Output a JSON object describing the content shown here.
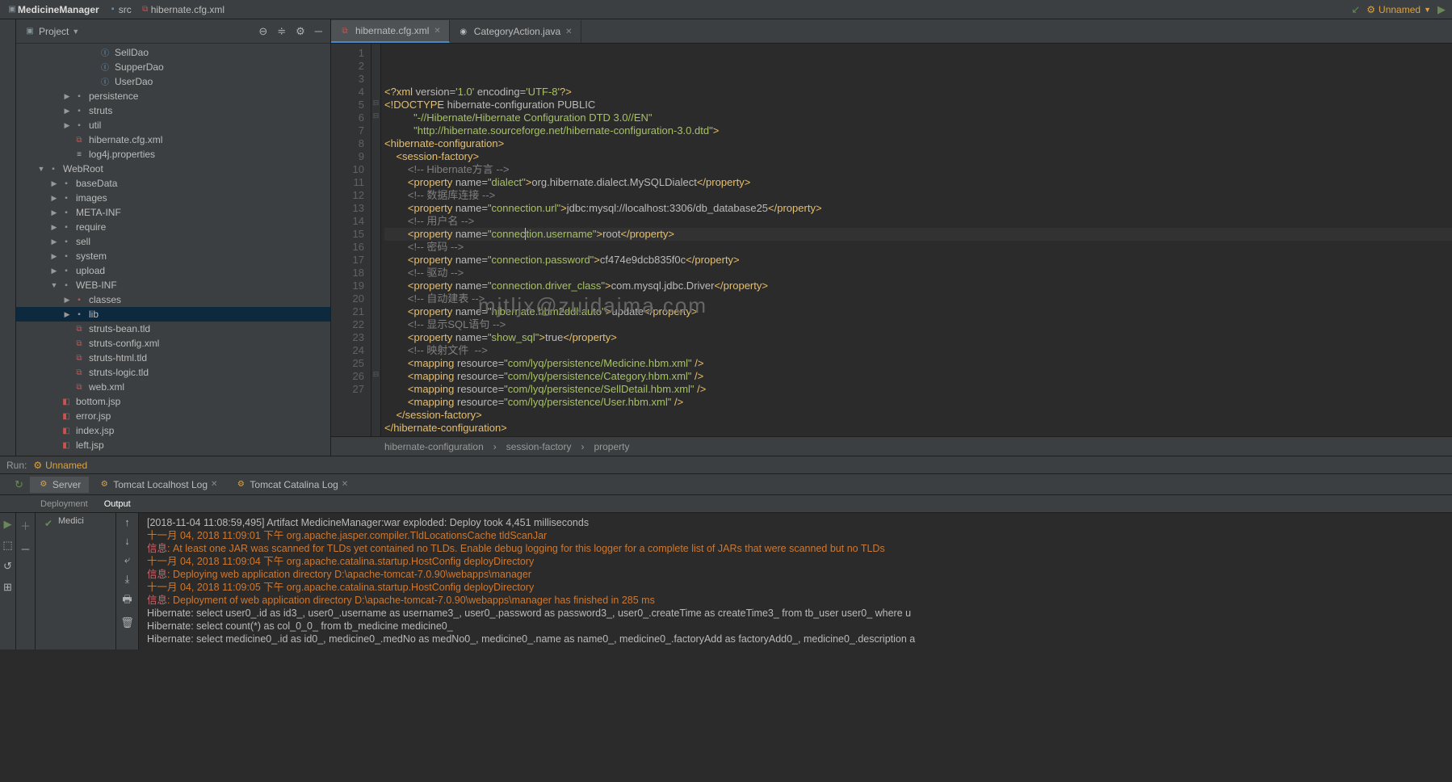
{
  "topBar": {
    "projectName": "MedicineManager",
    "path1": "src",
    "path2": "hibernate.cfg.xml",
    "runConfig": "Unnamed"
  },
  "projectPanel": {
    "title": "Project"
  },
  "tree": [
    {
      "indent": 5,
      "icon": "int",
      "label": "SellDao"
    },
    {
      "indent": 5,
      "icon": "int",
      "label": "SupperDao"
    },
    {
      "indent": 5,
      "icon": "int",
      "label": "UserDao"
    },
    {
      "indent": 3,
      "arrow": "▶",
      "icon": "folder",
      "label": "persistence"
    },
    {
      "indent": 3,
      "arrow": "▶",
      "icon": "folder",
      "label": "struts"
    },
    {
      "indent": 3,
      "arrow": "▶",
      "icon": "folder",
      "label": "util"
    },
    {
      "indent": 3,
      "icon": "xml",
      "label": "hibernate.cfg.xml"
    },
    {
      "indent": 3,
      "icon": "prop",
      "label": "log4j.properties"
    },
    {
      "indent": 1,
      "arrow": "▼",
      "icon": "folder",
      "label": "WebRoot"
    },
    {
      "indent": 2,
      "arrow": "▶",
      "icon": "folder",
      "label": "baseData"
    },
    {
      "indent": 2,
      "arrow": "▶",
      "icon": "folder",
      "label": "images"
    },
    {
      "indent": 2,
      "arrow": "▶",
      "icon": "folder",
      "label": "META-INF"
    },
    {
      "indent": 2,
      "arrow": "▶",
      "icon": "folder",
      "label": "require"
    },
    {
      "indent": 2,
      "arrow": "▶",
      "icon": "folder",
      "label": "sell"
    },
    {
      "indent": 2,
      "arrow": "▶",
      "icon": "folder",
      "label": "system"
    },
    {
      "indent": 2,
      "arrow": "▶",
      "icon": "folder",
      "label": "upload"
    },
    {
      "indent": 2,
      "arrow": "▼",
      "icon": "folder",
      "label": "WEB-INF"
    },
    {
      "indent": 3,
      "arrow": "▶",
      "icon": "folder-red",
      "label": "classes"
    },
    {
      "indent": 3,
      "arrow": "▶",
      "icon": "folder",
      "label": "lib",
      "selected": true
    },
    {
      "indent": 3,
      "icon": "xml",
      "label": "struts-bean.tld"
    },
    {
      "indent": 3,
      "icon": "xml",
      "label": "struts-config.xml"
    },
    {
      "indent": 3,
      "icon": "xml",
      "label": "struts-html.tld"
    },
    {
      "indent": 3,
      "icon": "xml",
      "label": "struts-logic.tld"
    },
    {
      "indent": 3,
      "icon": "xml",
      "label": "web.xml"
    },
    {
      "indent": 2,
      "icon": "jsp",
      "label": "bottom.jsp"
    },
    {
      "indent": 2,
      "icon": "jsp",
      "label": "error.jsp"
    },
    {
      "indent": 2,
      "icon": "jsp",
      "label": "index.jsp"
    },
    {
      "indent": 2,
      "icon": "jsp",
      "label": "left.jsp"
    }
  ],
  "tabs": [
    {
      "icon": "xml",
      "label": "hibernate.cfg.xml",
      "active": true
    },
    {
      "icon": "java",
      "label": "CategoryAction.java"
    }
  ],
  "code": {
    "lines": [
      {
        "n": 1,
        "html": "<span class='t-pi'>&lt;?xml</span><span class='t-attr'> version=</span><span class='t-str'>'1.0'</span><span class='t-attr'> encoding=</span><span class='t-str'>'UTF-8'</span><span class='t-pi'>?&gt;</span>"
      },
      {
        "n": 2,
        "html": "<span class='t-doctype'>&lt;!DOCTYPE</span><span class='t-text'> hibernate-configuration PUBLIC</span>"
      },
      {
        "n": 3,
        "html": "          <span class='t-str'>\"-//Hibernate/Hibernate Configuration DTD 3.0//EN\"</span>"
      },
      {
        "n": 4,
        "html": "          <span class='t-str'>\"http://hibernate.sourceforge.net/hibernate-configuration-3.0.dtd\"</span><span class='t-doctype'>&gt;</span>"
      },
      {
        "n": 5,
        "html": "<span class='t-tag'>&lt;hibernate-configuration&gt;</span>"
      },
      {
        "n": 6,
        "html": "    <span class='t-tag'>&lt;session-factory&gt;</span>"
      },
      {
        "n": 7,
        "html": "        <span class='t-comment'>&lt;!-- Hibernate方言 --&gt;</span>"
      },
      {
        "n": 8,
        "html": "        <span class='t-tag'>&lt;property</span><span class='t-attr'> name=</span><span class='t-str'>\"dialect\"</span><span class='t-tag'>&gt;</span><span class='t-text'>org.hibernate.dialect.MySQLDialect</span><span class='t-tag'>&lt;/property&gt;</span>"
      },
      {
        "n": 9,
        "html": "        <span class='t-comment'>&lt;!-- 数据库连接 --&gt;</span>"
      },
      {
        "n": 10,
        "html": "        <span class='t-tag'>&lt;property</span><span class='t-attr'> name=</span><span class='t-str'>\"connection.url\"</span><span class='t-tag'>&gt;</span><span class='t-text'>jdbc:mysql://localhost:3306/db_database25</span><span class='t-tag'>&lt;/property&gt;</span>"
      },
      {
        "n": 11,
        "html": "        <span class='t-comment'>&lt;!-- 用户名 --&gt;</span>"
      },
      {
        "n": 12,
        "hl": true,
        "html": "        <span class='t-tag'>&lt;property</span><span class='t-attr'> name=</span><span class='t-str'>\"connec<span style='border-left:1px solid #bbb'>t</span>ion.username\"</span><span class='t-tag'>&gt;</span><span class='t-text'>root</span><span class='t-tag'>&lt;/property&gt;</span>"
      },
      {
        "n": 13,
        "html": "        <span class='t-comment'>&lt;!-- 密码 --&gt;</span>"
      },
      {
        "n": 14,
        "html": "        <span class='t-tag'>&lt;property</span><span class='t-attr'> name=</span><span class='t-str'>\"connection.password\"</span><span class='t-tag'>&gt;</span><span class='t-text'>cf474e9dcb835f0c</span><span class='t-tag'>&lt;/property&gt;</span>"
      },
      {
        "n": 15,
        "html": "        <span class='t-comment'>&lt;!-- 驱动 --&gt;</span>"
      },
      {
        "n": 16,
        "html": "        <span class='t-tag'>&lt;property</span><span class='t-attr'> name=</span><span class='t-str'>\"connection.driver_class\"</span><span class='t-tag'>&gt;</span><span class='t-text'>com.mysql.jdbc.Driver</span><span class='t-tag'>&lt;/property&gt;</span>"
      },
      {
        "n": 17,
        "html": "        <span class='t-comment'>&lt;!-- 自动建表 --&gt;</span>"
      },
      {
        "n": 18,
        "html": "        <span class='t-tag'>&lt;property</span><span class='t-attr'> name=</span><span class='t-str'>\"hibernate.hbm2ddl.auto\"</span><span class='t-tag'>&gt;</span><span class='t-text'>update</span><span class='t-tag'>&lt;/property&gt;</span>"
      },
      {
        "n": 19,
        "html": "        <span class='t-comment'>&lt;!-- 显示SQL语句 --&gt;</span>"
      },
      {
        "n": 20,
        "html": "        <span class='t-tag'>&lt;property</span><span class='t-attr'> name=</span><span class='t-str'>\"show_sql\"</span><span class='t-tag'>&gt;</span><span class='t-text'>true</span><span class='t-tag'>&lt;/property&gt;</span>"
      },
      {
        "n": 21,
        "html": "        <span class='t-comment'>&lt;!-- 映射文件  --&gt;</span>"
      },
      {
        "n": 22,
        "html": "        <span class='t-tag'>&lt;mapping</span><span class='t-attr'> resource=</span><span class='t-str'>\"com/lyq/persistence/Medicine.hbm.xml\"</span><span class='t-tag'> /&gt;</span>"
      },
      {
        "n": 23,
        "html": "        <span class='t-tag'>&lt;mapping</span><span class='t-attr'> resource=</span><span class='t-str'>\"com/lyq/persistence/Category.hbm.xml\"</span><span class='t-tag'> /&gt;</span>"
      },
      {
        "n": 24,
        "html": "        <span class='t-tag'>&lt;mapping</span><span class='t-attr'> resource=</span><span class='t-str'>\"com/lyq/persistence/SellDetail.hbm.xml\"</span><span class='t-tag'> /&gt;</span>"
      },
      {
        "n": 25,
        "html": "        <span class='t-tag'>&lt;mapping</span><span class='t-attr'> resource=</span><span class='t-str'>\"com/lyq/persistence/User.hbm.xml\"</span><span class='t-tag'> /&gt;</span>"
      },
      {
        "n": 26,
        "html": "    <span class='t-tag'>&lt;/session-factory&gt;</span>"
      },
      {
        "n": 27,
        "html": "<span class='t-tag'>&lt;/hibernate-configuration&gt;</span>"
      }
    ]
  },
  "breadcrumb": {
    "a": "hibernate-configuration",
    "b": "session-factory",
    "c": "property"
  },
  "runPanel": {
    "label": "Run:",
    "config": "Unnamed"
  },
  "bottomTabs": [
    {
      "label": "Server",
      "active": true
    },
    {
      "label": "Tomcat Localhost Log",
      "close": true
    },
    {
      "label": "Tomcat Catalina Log",
      "close": true
    }
  ],
  "subTabs": {
    "a": "Deployment",
    "b": "Output"
  },
  "midLabel": "Medici",
  "console": [
    {
      "cls": "white",
      "text": "[2018-11-04 11:08:59,495] Artifact MedicineManager:war exploded: Deploy took 4,451 milliseconds"
    },
    {
      "cls": "red",
      "text": "十一月 04, 2018 11:09:01 下午 org.apache.jasper.compiler.TldLocationsCache tldScanJar"
    },
    {
      "cls": "info",
      "text": "信息: At least one JAR was scanned for TLDs yet contained no TLDs. Enable debug logging for this logger for a complete list of JARs that were scanned but no TLDs"
    },
    {
      "cls": "red",
      "text": "十一月 04, 2018 11:09:04 下午 org.apache.catalina.startup.HostConfig deployDirectory"
    },
    {
      "cls": "info",
      "text": "信息: Deploying web application directory D:\\apache-tomcat-7.0.90\\webapps\\manager"
    },
    {
      "cls": "red",
      "text": "十一月 04, 2018 11:09:05 下午 org.apache.catalina.startup.HostConfig deployDirectory"
    },
    {
      "cls": "info",
      "text": "信息: Deployment of web application directory D:\\apache-tomcat-7.0.90\\webapps\\manager has finished in 285 ms"
    },
    {
      "cls": "white",
      "text": "Hibernate: select user0_.id as id3_, user0_.username as username3_, user0_.password as password3_, user0_.createTime as createTime3_ from tb_user user0_ where u"
    },
    {
      "cls": "white",
      "text": "Hibernate: select count(*) as col_0_0_ from tb_medicine medicine0_"
    },
    {
      "cls": "white",
      "text": "Hibernate: select medicine0_.id as id0_, medicine0_.medNo as medNo0_, medicine0_.name as name0_, medicine0_.factoryAdd as factoryAdd0_, medicine0_.description a"
    }
  ],
  "watermark": "mjtljx@zuidaima.com"
}
